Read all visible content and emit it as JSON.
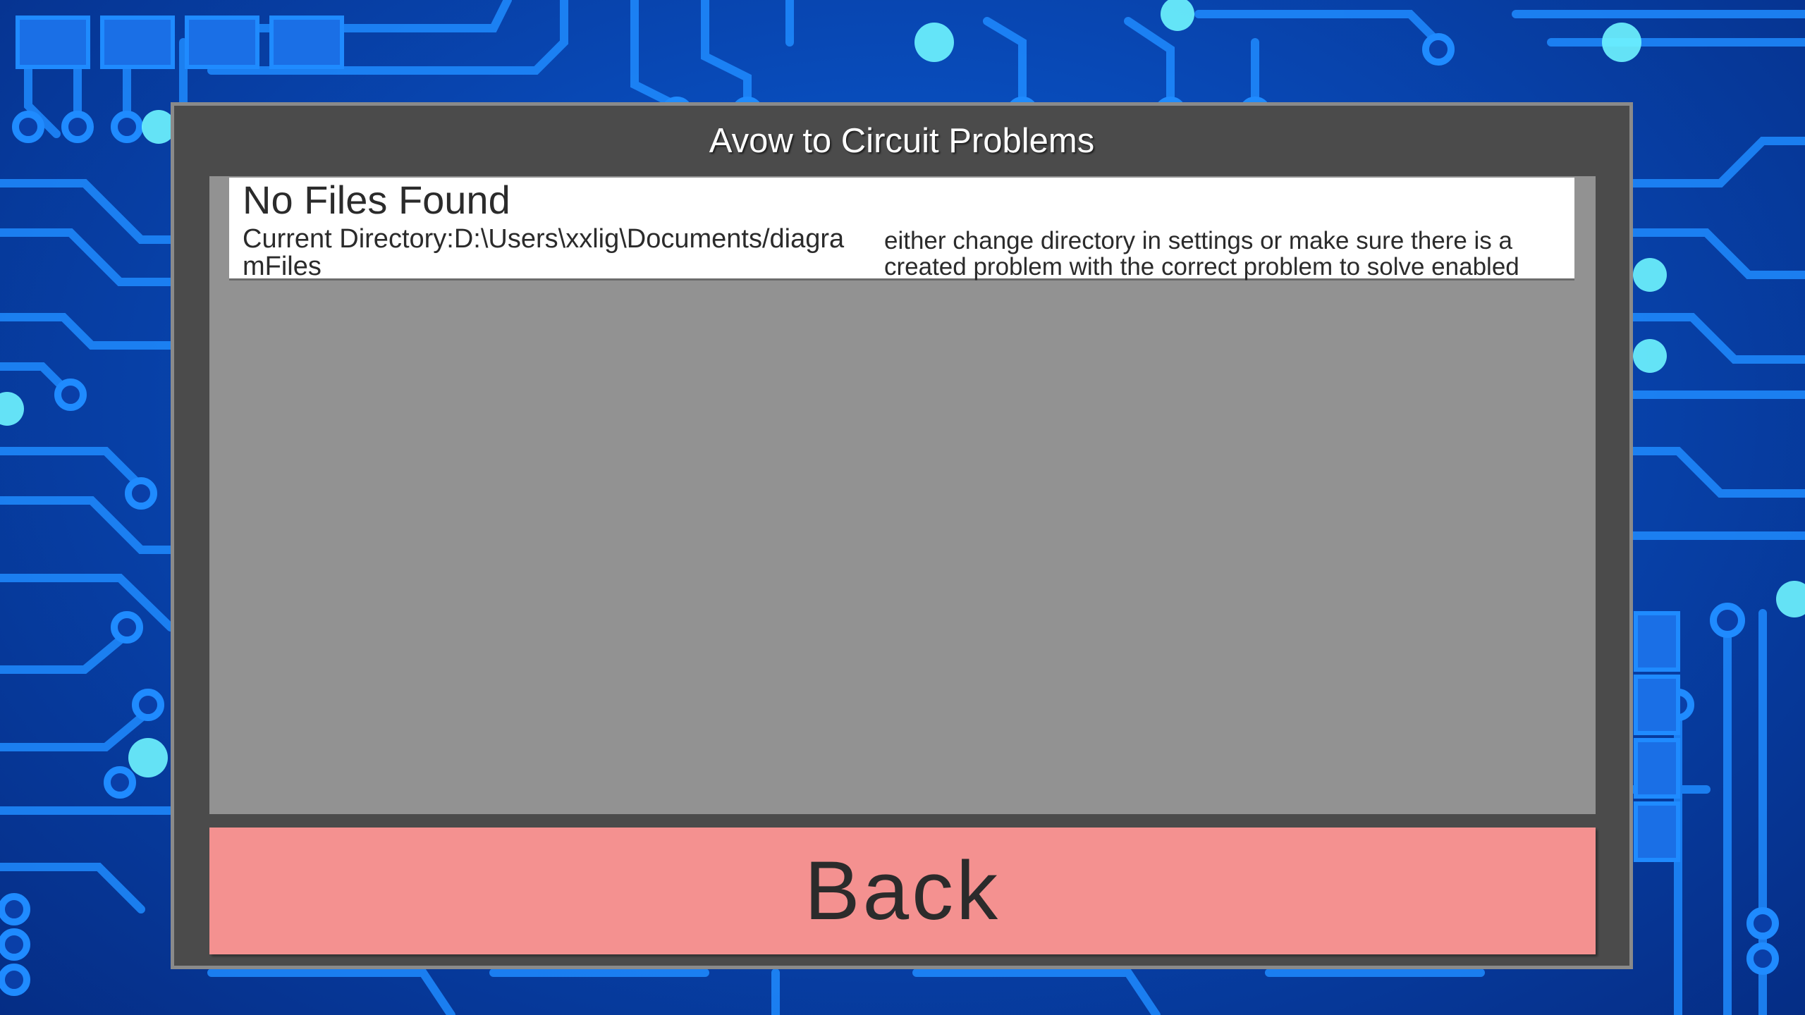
{
  "colors": {
    "background": "#0847b3",
    "circuit_trace": "#1f8bff",
    "glow": "#4ff0ff",
    "dialog": "#4b4b4b",
    "list_area": "#929292",
    "back_button": "#f49190"
  },
  "dialog": {
    "title": "Avow to Circuit Problems"
  },
  "list": {
    "items": [
      {
        "title": "No Files Found",
        "directory": "Current Directory:D:\\Users\\xxlig\\Documents/diagramFiles",
        "hint": "either change directory in settings or make sure there is a created problem with the correct problem to solve enabled"
      }
    ]
  },
  "back_button": {
    "label": "Back"
  }
}
